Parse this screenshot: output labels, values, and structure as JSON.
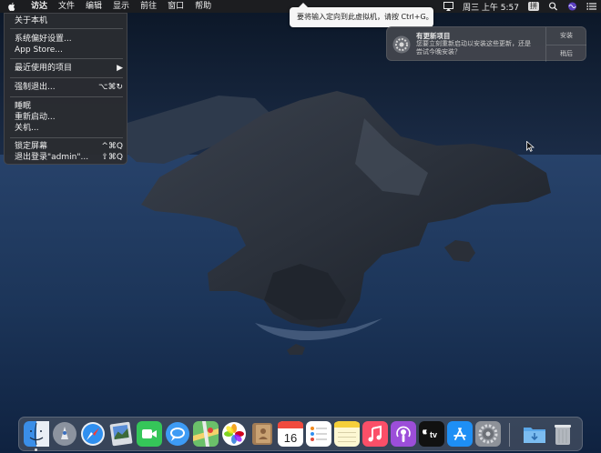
{
  "menubar": {
    "items": [
      "访达",
      "文件",
      "编辑",
      "显示",
      "前往",
      "窗口",
      "帮助"
    ],
    "clock": "周三 上午 5:57",
    "ime_label": "拼"
  },
  "apple_menu": {
    "items": [
      {
        "label": "关于本机",
        "shortcut": ""
      },
      {
        "label": "系统偏好设置...",
        "shortcut": ""
      },
      {
        "label": "App Store...",
        "shortcut": ""
      },
      {
        "label": "最近使用的项目",
        "shortcut": "▶"
      },
      {
        "label": "强制退出...",
        "shortcut": "⌥⌘↻"
      },
      {
        "label": "睡眠",
        "shortcut": ""
      },
      {
        "label": "重新启动...",
        "shortcut": ""
      },
      {
        "label": "关机...",
        "shortcut": ""
      },
      {
        "label": "锁定屏幕",
        "shortcut": "^⌘Q"
      },
      {
        "label": "退出登录\"admin\"...",
        "shortcut": "⇧⌘Q"
      }
    ]
  },
  "tooltip": {
    "text": "要将输入定向到此虚拟机，请按 Ctrl+G。"
  },
  "notification": {
    "title": "有更新项目",
    "body": "您要立刻重新启动以安装这些更新，还是尝试今晚安装？",
    "button_install": "安装",
    "button_later": "稍后"
  },
  "dock": {
    "apps": [
      {
        "name": "finder-icon",
        "running": true
      },
      {
        "name": "launchpad-icon",
        "running": false
      },
      {
        "name": "safari-icon",
        "running": false
      },
      {
        "name": "preview-icon",
        "running": false
      },
      {
        "name": "facetime-icon",
        "running": false
      },
      {
        "name": "messages-icon",
        "running": false
      },
      {
        "name": "maps-icon",
        "running": false
      },
      {
        "name": "photos-icon",
        "running": false
      },
      {
        "name": "contacts-icon",
        "running": false
      },
      {
        "name": "calendar-icon",
        "running": false
      },
      {
        "name": "reminders-icon",
        "running": false
      },
      {
        "name": "notes-icon",
        "running": false
      },
      {
        "name": "music-icon",
        "running": false
      },
      {
        "name": "podcasts-icon",
        "running": false
      },
      {
        "name": "tv-icon",
        "running": false
      },
      {
        "name": "app-store-icon",
        "running": false
      },
      {
        "name": "system-preferences-icon",
        "running": false
      },
      {
        "name": "downloads-folder-icon",
        "running": false
      },
      {
        "name": "trash-icon",
        "running": false
      }
    ],
    "calendar_day": "16",
    "tv_label": "tv"
  }
}
